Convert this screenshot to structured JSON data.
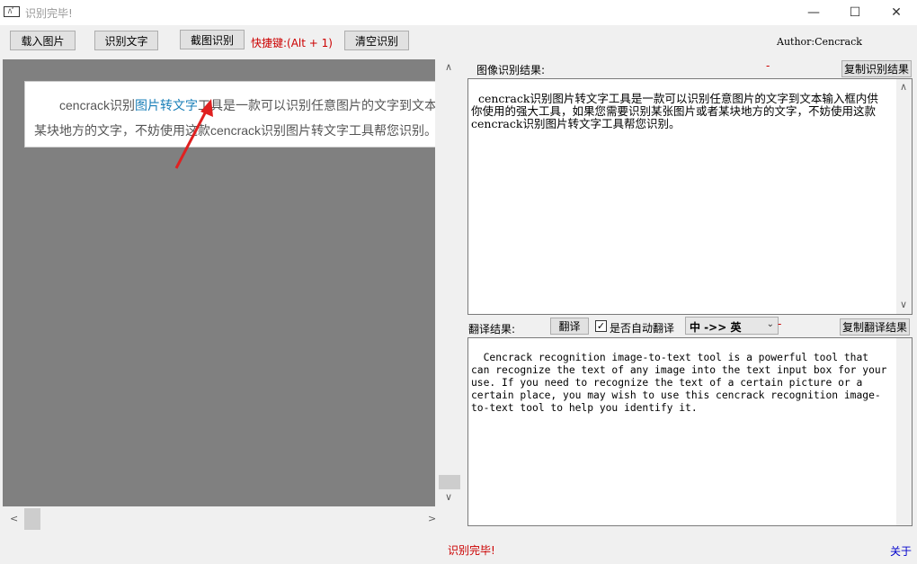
{
  "window": {
    "title": "识别完毕!",
    "icon_text": "ﾊﾞ",
    "minimize": "—",
    "maximize": "☐",
    "close": "✕"
  },
  "toolbar": {
    "load_image": "载入图片",
    "recognize_text": "识别文字",
    "screenshot_recognize": "截图识别",
    "shortcut": "快捷键:(Alt + 1)",
    "clear": "清空识别",
    "author": "Author:Cencrack"
  },
  "image_snippet": {
    "line1_a": "cencrack识别",
    "line1_link": "图片转文字",
    "line1_b": "工具是一款可以识别任意图片的文字到文本",
    "line2": "某块地方的文字，不妨使用这款cencrack识别图片转文字工具帮您识别。"
  },
  "result": {
    "label": "图像识别结果:",
    "dash": "-",
    "copy_button": "复制识别结果",
    "text": "cencrack识别图片转文字工具是一款可以识别任意图片的文字到文本输入框内供你使用的强大工具，如果您需要识别某张图片或者某块地方的文字，不妨使用这款cencrack识别图片转文字工具帮您识别。"
  },
  "translate": {
    "label": "翻译结果:",
    "button": "翻译",
    "auto_checkbox_label": "是否自动翻译",
    "auto_checked": true,
    "direction": "中 ->> 英",
    "dash": "-",
    "copy_button": "复制翻译结果",
    "text": "Cencrack recognition image-to-text tool is a powerful tool that can recognize the text of any image into the text input box for your use. If you need to recognize the text of a certain picture or a certain place, you may wish to use this cencrack recognition image-to-text tool to help you identify it."
  },
  "status": {
    "text": "识别完毕!",
    "about": "关于"
  },
  "colors": {
    "status_red": "#cc0000",
    "pane_gray": "#808080",
    "arrow_red": "#e02020",
    "link_blue": "#1a7fb8"
  }
}
